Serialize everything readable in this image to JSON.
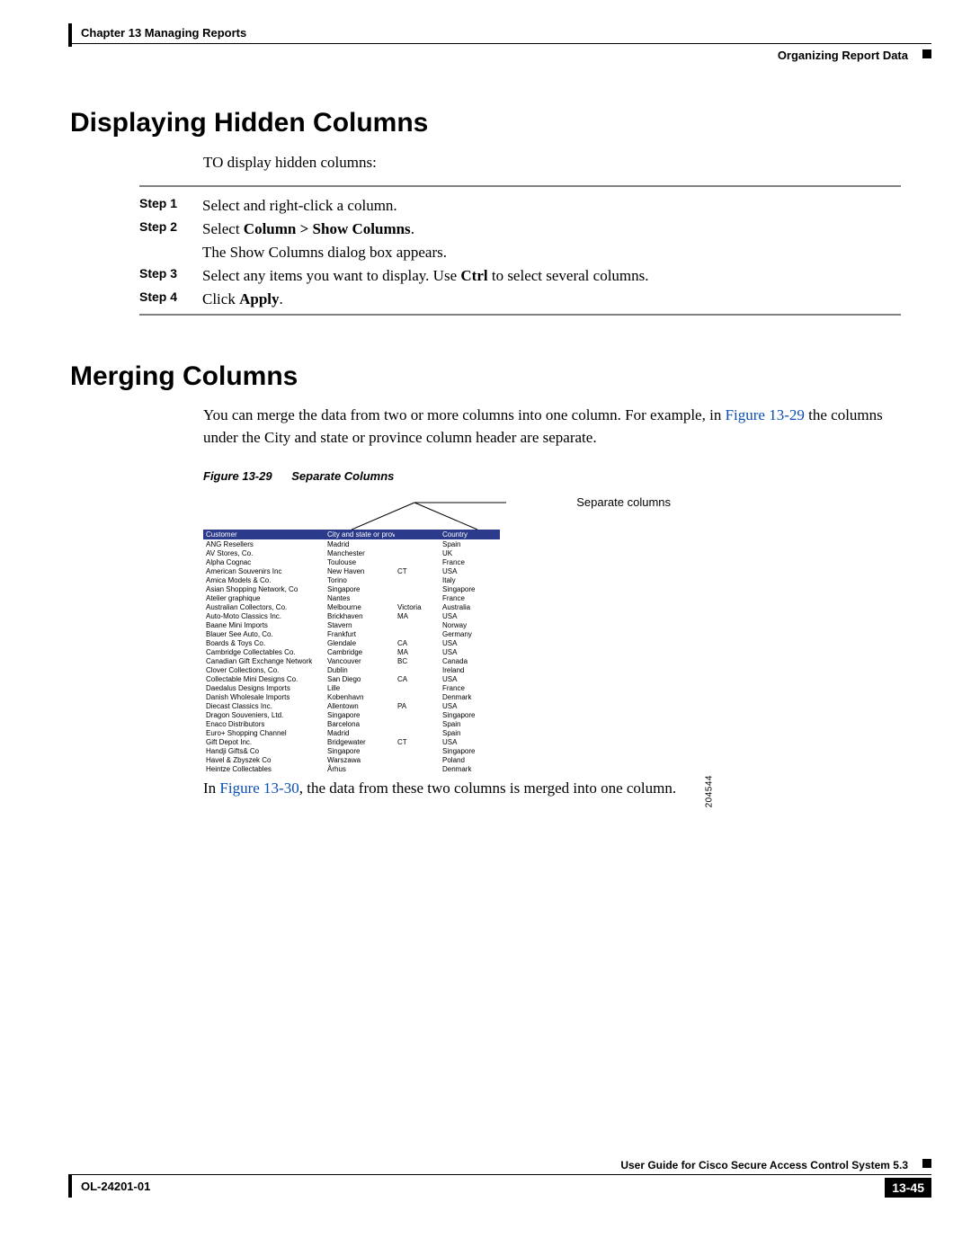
{
  "header": {
    "chapter": "Chapter 13    Managing Reports",
    "section": "Organizing Report Data"
  },
  "section1": {
    "title": "Displaying Hidden Columns",
    "intro": "TO display hidden columns:",
    "steps": [
      {
        "label": "Step 1",
        "html": "Select and right-click a column."
      },
      {
        "label": "Step 2",
        "html": "Select <b>Column > Show Columns</b>."
      },
      {
        "label": "",
        "html": "The Show Columns dialog box appears."
      },
      {
        "label": "Step 3",
        "html": "Select any items you want to display. Use <b>Ctrl</b> to select several columns."
      },
      {
        "label": "Step 4",
        "html": "Click <b>Apply</b>."
      }
    ]
  },
  "section2": {
    "title": "Merging Columns",
    "intro_pre": "You can merge the data from two or more columns into one column. For example, in ",
    "intro_link": "Figure 13-29",
    "intro_post": " the columns under the City and state or province column header are separate.",
    "figure_label": "Figure 13-29",
    "figure_title": "Separate Columns",
    "callout": "Separate columns",
    "figure_id": "204544",
    "post_pre": "In ",
    "post_link": "Figure 13-30",
    "post_post": ", the data from these two columns is merged into one column."
  },
  "table": {
    "headers": [
      "Customer",
      "City and state or province",
      "",
      "Country"
    ],
    "rows": [
      [
        "ANG Resellers",
        "Madrid",
        "",
        "Spain"
      ],
      [
        "AV Stores, Co.",
        "Manchester",
        "",
        "UK"
      ],
      [
        "Alpha Cognac",
        "Toulouse",
        "",
        "France"
      ],
      [
        "American Souvenirs Inc",
        "New Haven",
        "CT",
        "USA"
      ],
      [
        "Amica Models & Co.",
        "Torino",
        "",
        "Italy"
      ],
      [
        "Asian Shopping Network, Co",
        "Singapore",
        "",
        "Singapore"
      ],
      [
        "Atelier graphique",
        "Nantes",
        "",
        "France"
      ],
      [
        "Australian Collectors, Co.",
        "Melbourne",
        "Victoria",
        "Australia"
      ],
      [
        "Auto-Moto Classics Inc.",
        "Brickhaven",
        "MA",
        "USA"
      ],
      [
        "Baane Mini Imports",
        "Stavern",
        "",
        "Norway"
      ],
      [
        "Blauer See Auto, Co.",
        "Frankfurt",
        "",
        "Germany"
      ],
      [
        "Boards & Toys Co.",
        "Glendale",
        "CA",
        "USA"
      ],
      [
        "Cambridge Collectables Co.",
        "Cambridge",
        "MA",
        "USA"
      ],
      [
        "Canadian Gift Exchange Network",
        "Vancouver",
        "BC",
        "Canada"
      ],
      [
        "Clover Collections, Co.",
        "Dublin",
        "",
        "Ireland"
      ],
      [
        "Collectable Mini Designs Co.",
        "San Diego",
        "CA",
        "USA"
      ],
      [
        "Daedalus Designs Imports",
        "Lille",
        "",
        "France"
      ],
      [
        "Danish Wholesale Imports",
        "Kobenhavn",
        "",
        "Denmark"
      ],
      [
        "Diecast Classics Inc.",
        "Allentown",
        "PA",
        "USA"
      ],
      [
        "Dragon Souveniers, Ltd.",
        "Singapore",
        "",
        "Singapore"
      ],
      [
        "Enaco Distributors",
        "Barcelona",
        "",
        "Spain"
      ],
      [
        "Euro+ Shopping Channel",
        "Madrid",
        "",
        "Spain"
      ],
      [
        "Gift Depot Inc.",
        "Bridgewater",
        "CT",
        "USA"
      ],
      [
        "Handji Gifts& Co",
        "Singapore",
        "",
        "Singapore"
      ],
      [
        "Havel & Zbyszek Co",
        "Warszawa",
        "",
        "Poland"
      ],
      [
        "Heintze Collectables",
        "Århus",
        "",
        "Denmark"
      ]
    ]
  },
  "footer": {
    "doc_id": "OL-24201-01",
    "guide": "User Guide for Cisco Secure Access Control System 5.3",
    "page": "13-45"
  }
}
